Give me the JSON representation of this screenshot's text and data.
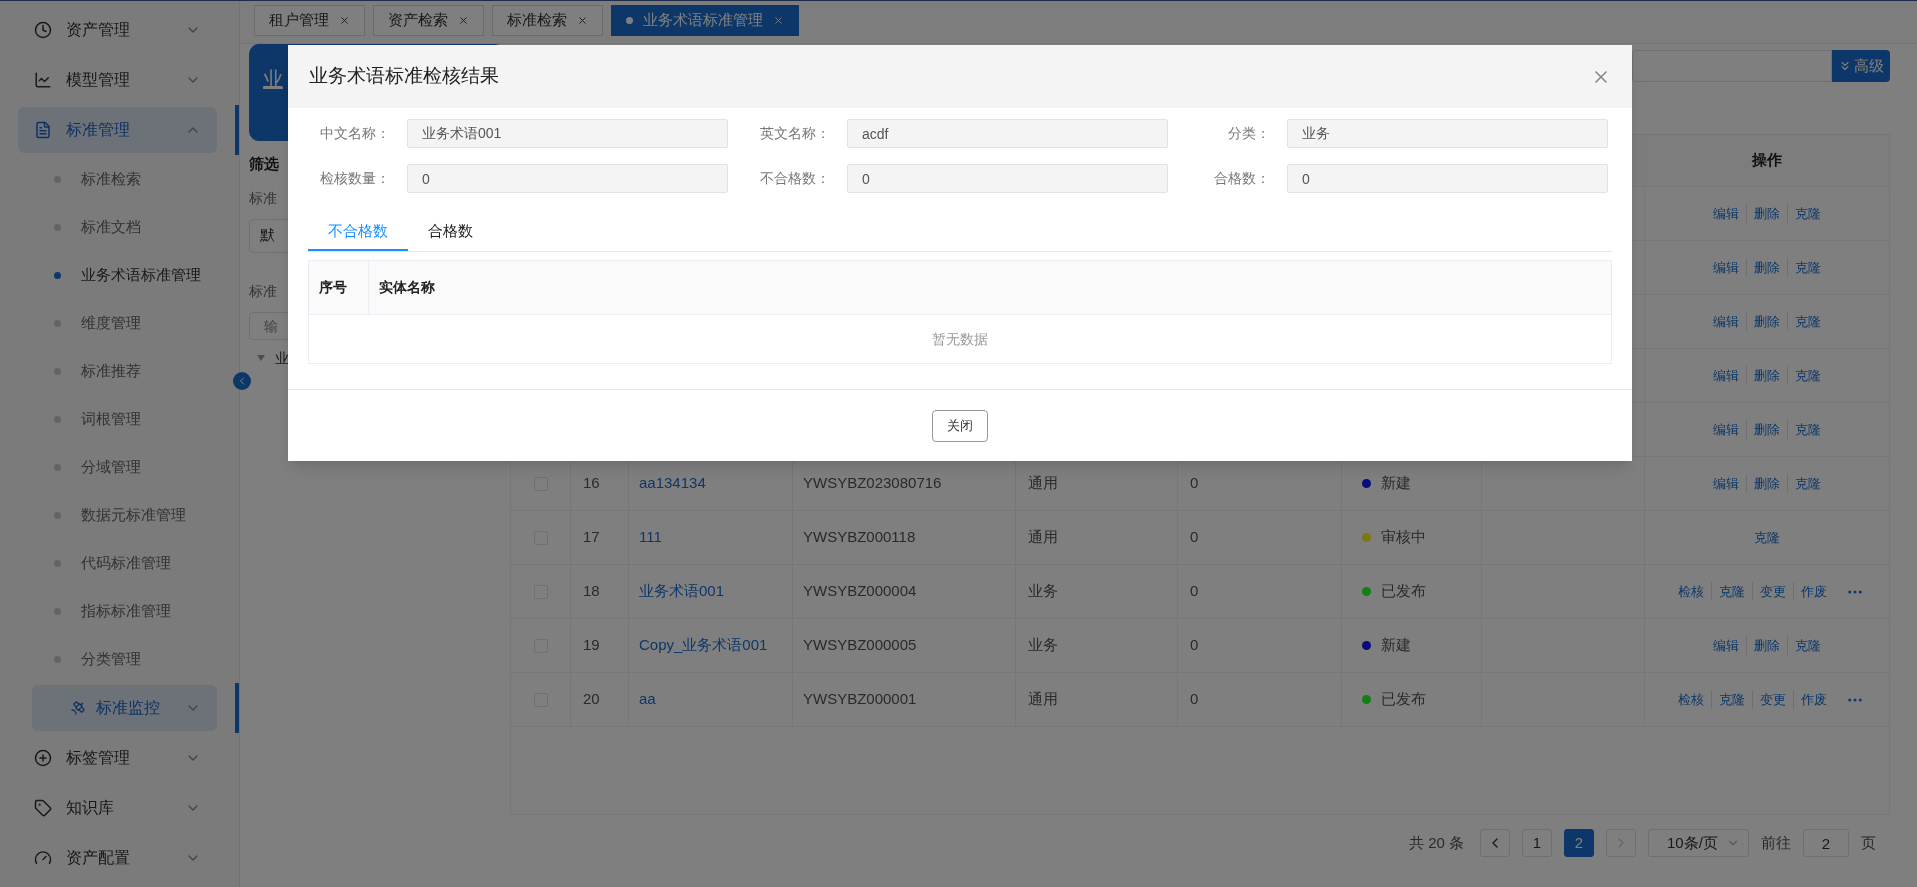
{
  "sidebar": {
    "items": [
      {
        "label": "资产管理",
        "expanded": false,
        "active": false
      },
      {
        "label": "模型管理",
        "expanded": false,
        "active": false
      },
      {
        "label": "标准管理",
        "expanded": true,
        "active": true,
        "children": [
          {
            "label": "标准检索",
            "kind": "link",
            "selected": false
          },
          {
            "label": "标准文档",
            "kind": "link",
            "selected": false
          },
          {
            "label": "业务术语标准管理",
            "kind": "link",
            "selected": true
          },
          {
            "label": "维度管理",
            "kind": "link",
            "selected": false
          },
          {
            "label": "标准推荐",
            "kind": "link",
            "selected": false
          },
          {
            "label": "词根管理",
            "kind": "link",
            "selected": false
          },
          {
            "label": "分域管理",
            "kind": "link",
            "selected": false
          },
          {
            "label": "数据元标准管理",
            "kind": "link",
            "selected": false
          },
          {
            "label": "代码标准管理",
            "kind": "link",
            "selected": false
          },
          {
            "label": "指标标准管理",
            "kind": "link",
            "selected": false
          },
          {
            "label": "分类管理",
            "kind": "link",
            "selected": false
          },
          {
            "label": "标准监控",
            "kind": "submenu",
            "active": true,
            "expanded": false
          }
        ]
      },
      {
        "label": "标签管理",
        "expanded": false,
        "active": false
      },
      {
        "label": "知识库",
        "expanded": false,
        "active": false
      },
      {
        "label": "资产配置",
        "expanded": false,
        "active": false
      }
    ]
  },
  "tabs": [
    {
      "label": "租户管理",
      "selected": false
    },
    {
      "label": "资产检索",
      "selected": false
    },
    {
      "label": "标准检索",
      "selected": false
    },
    {
      "label": "业务术语标准管理",
      "selected": true
    }
  ],
  "left_panel": {
    "card_title": "业",
    "filter_heading": "筛选",
    "label_1": "标准",
    "select_value": "默",
    "label_2": "标准",
    "search_placeholder": "输",
    "tree": [
      {
        "label": "业",
        "expanded": true
      }
    ]
  },
  "search": {
    "button": "高级"
  },
  "table": {
    "actions_header": "操作",
    "rows": [
      {
        "actions": [
          "编辑",
          "删除",
          "克隆"
        ],
        "more": false
      },
      {
        "actions": [
          "编辑",
          "删除",
          "克隆"
        ],
        "more": false
      },
      {
        "actions": [
          "编辑",
          "删除",
          "克隆"
        ],
        "more": false
      },
      {
        "actions": [
          "编辑",
          "删除",
          "克隆"
        ],
        "more": false
      },
      {
        "actions": [
          "编辑",
          "删除",
          "克隆"
        ],
        "more": false
      },
      {
        "checked": false,
        "index": "16",
        "name": "aa134134",
        "code": "YWSYBZ023080716",
        "type": "通用",
        "count": "0",
        "status": "新建",
        "color": "#0b0b80",
        "actions": [
          "编辑",
          "删除",
          "克隆"
        ],
        "more": false
      },
      {
        "checked": false,
        "index": "17",
        "name": "111",
        "code": "YWSYBZ000118",
        "type": "通用",
        "count": "0",
        "status": "审核中",
        "color": "#7a7a0d",
        "actions": [
          "克隆"
        ],
        "more": false
      },
      {
        "checked": false,
        "index": "18",
        "name": "业务术语001",
        "code": "YWSYBZ000004",
        "type": "业务",
        "count": "0",
        "status": "已发布",
        "color": "#128012",
        "actions": [
          "检核",
          "克隆",
          "变更",
          "作废"
        ],
        "more": true
      },
      {
        "checked": false,
        "index": "19",
        "name": "Copy_业务术语001",
        "code": "YWSYBZ000005",
        "type": "业务",
        "count": "0",
        "status": "新建",
        "color": "#0b0b80",
        "actions": [
          "编辑",
          "删除",
          "克隆"
        ],
        "more": false
      },
      {
        "checked": false,
        "index": "20",
        "name": "aa",
        "code": "YWSYBZ000001",
        "type": "通用",
        "count": "0",
        "status": "已发布",
        "color": "#128012",
        "actions": [
          "检核",
          "克隆",
          "变更",
          "作废"
        ],
        "more": true
      }
    ]
  },
  "pagination": {
    "total": "共 20 条",
    "prev_disabled": false,
    "pages": [
      {
        "label": "1",
        "selected": false
      },
      {
        "label": "2",
        "selected": true
      }
    ],
    "next_disabled": true,
    "page_size": "10条/页",
    "goto_label": "前往",
    "goto_value": "2",
    "goto_suffix": "页"
  },
  "modal": {
    "title": "业务术语标准检核结果",
    "fields": [
      {
        "label": "中文名称：",
        "value": "业务术语001"
      },
      {
        "label": "英文名称：",
        "value": "acdf"
      },
      {
        "label": "分类：",
        "value": "业务"
      },
      {
        "label": "检核数量：",
        "value": "0"
      },
      {
        "label": "不合格数：",
        "value": "0"
      },
      {
        "label": "合格数：",
        "value": "0"
      }
    ],
    "tabs": [
      {
        "label": "不合格数",
        "selected": true
      },
      {
        "label": "合格数",
        "selected": false
      }
    ],
    "table": {
      "columns": [
        "序号",
        "实体名称"
      ],
      "empty_text": "暂无数据"
    },
    "button": "关闭"
  }
}
